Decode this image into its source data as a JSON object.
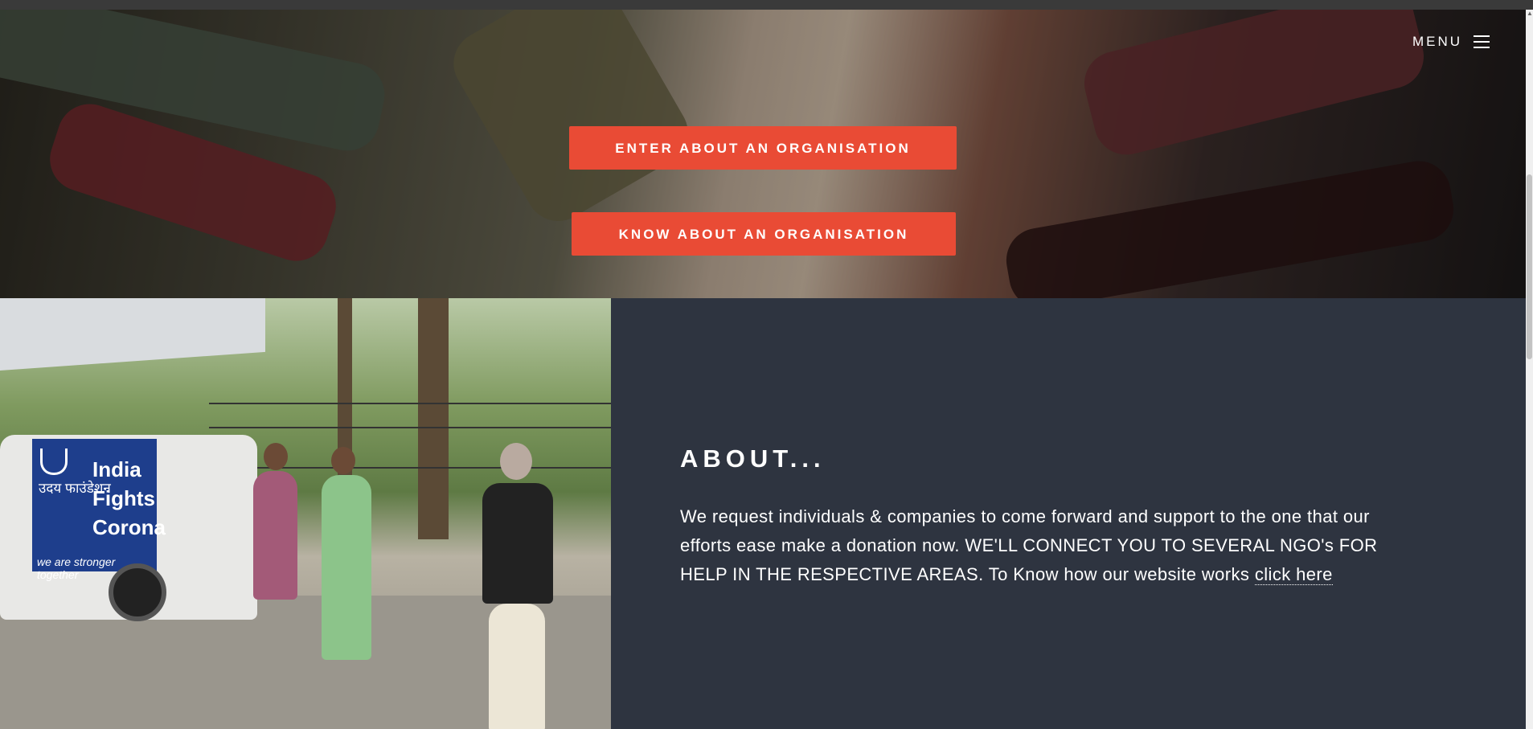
{
  "header": {
    "menu_label": "MENU",
    "menu_icon": "hamburger-icon"
  },
  "hero": {
    "enter_button": "ENTER ABOUT AN ORGANISATION",
    "know_button": "KNOW ABOUT AN ORGANISATION"
  },
  "photo": {
    "banner_title": "India Fights Corona",
    "banner_org": "उदय फाउंडेशन",
    "banner_tagline": "we are stronger together"
  },
  "about": {
    "heading": "ABOUT...",
    "body": "We request individuals & companies to come forward and support to the one that our efforts ease make a donation now. WE'LL CONNECT YOU TO SEVERAL NGO's FOR HELP IN THE RESPECTIVE AREAS. To Know how our website works ",
    "link_label": "click here"
  },
  "colors": {
    "accent": "#e94b35",
    "panel": "#2e3440"
  }
}
